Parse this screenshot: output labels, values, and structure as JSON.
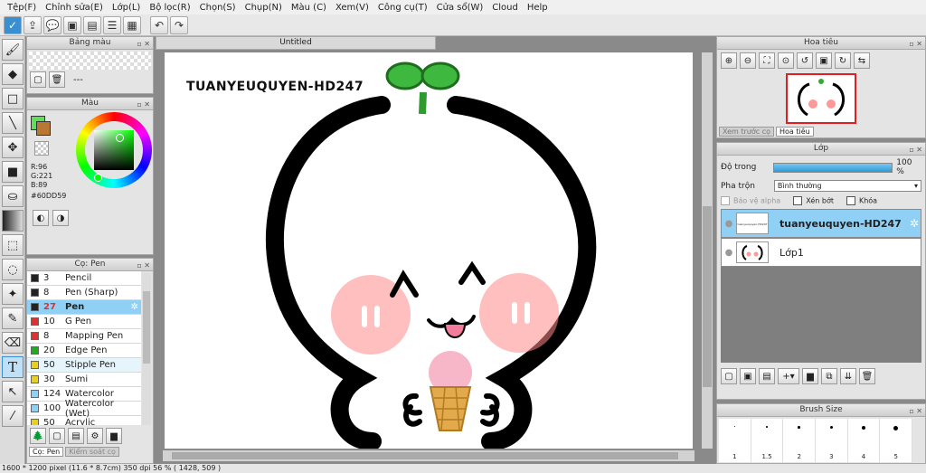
{
  "menu": [
    "Tệp(F)",
    "Chỉnh sửa(E)",
    "Lớp(L)",
    "Bộ lọc(R)",
    "Chọn(S)",
    "Chụp(N)",
    "Màu (C)",
    "Xem(V)",
    "Công cụ(T)",
    "Cửa sổ(W)",
    "Cloud",
    "Help"
  ],
  "palette_panel": {
    "title": "Bảng màu",
    "dash": "---"
  },
  "color_panel": {
    "title": "Màu",
    "r": "R:96",
    "g": "G:221",
    "b": "B:89",
    "hex": "#60DD59"
  },
  "brush_panel": {
    "title": "Cọ: Pen",
    "brushes": [
      {
        "size": "3",
        "name": "Pencil",
        "color": "#222222"
      },
      {
        "size": "8",
        "name": "Pen (Sharp)",
        "color": "#222222"
      },
      {
        "size": "27",
        "name": "Pen",
        "color": "#222222"
      },
      {
        "size": "10",
        "name": "G Pen",
        "color": "#e03030"
      },
      {
        "size": "8",
        "name": "Mapping Pen",
        "color": "#e03030"
      },
      {
        "size": "20",
        "name": "Edge Pen",
        "color": "#22aa22"
      },
      {
        "size": "50",
        "name": "Stipple Pen",
        "color": "#e8d020"
      },
      {
        "size": "30",
        "name": "Sumi",
        "color": "#e8d020"
      },
      {
        "size": "124",
        "name": "Watercolor",
        "color": "#8fd0f4"
      },
      {
        "size": "100",
        "name": "Watercolor (Wet)",
        "color": "#8fd0f4"
      },
      {
        "size": "50",
        "name": "Acrylic",
        "color": "#e8d020"
      }
    ],
    "tab1": "Cọ: Pen",
    "tab2": "Kiểm soát cọ"
  },
  "canvas": {
    "tab_title": "Untitled",
    "artwork_text": "TUANYEUQUYEN-HD247"
  },
  "navigator": {
    "title": "Hoa tiêu",
    "tab1": "Xem trước cọ",
    "tab2": "Hoa tiêu"
  },
  "layer_panel": {
    "title": "Lớp",
    "opacity_label": "Độ trong",
    "opacity_value": "100 %",
    "opacity_fraction": 1.0,
    "blend_label": "Pha trộn",
    "blend_value": "Bình thường",
    "protect_alpha": "Bảo vệ alpha",
    "clipping": "Xén bớt",
    "lock": "Khóa",
    "layers": [
      {
        "name": "tuanyeuquyen-HD247",
        "thumb": "tuanyeuquyen-HD247",
        "selected": true
      },
      {
        "name": "Lớp1",
        "selected": false
      }
    ]
  },
  "brush_size": {
    "title": "Brush Size",
    "sizes": [
      "1",
      "1.5",
      "2",
      "3",
      "4",
      "5"
    ]
  },
  "status": "1600 * 1200 pixel   (11.6 * 8.7cm)   350 dpi   56 %   ( 1428, 509 )"
}
